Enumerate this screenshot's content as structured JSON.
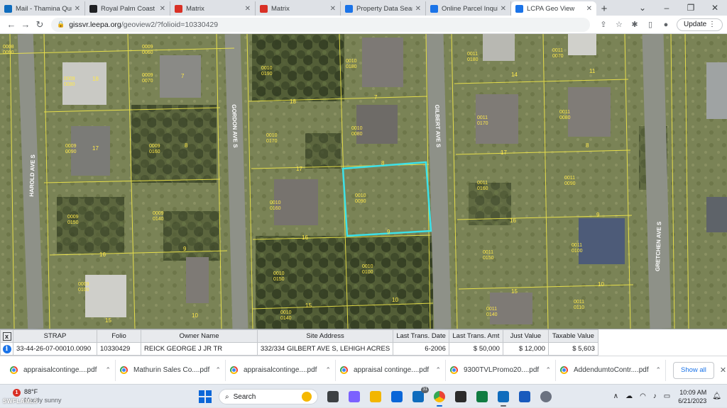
{
  "browser": {
    "tabs": [
      {
        "title": "Mail - Thamina Qures",
        "favicon": "outlook-icon",
        "color": "#0f6cbd",
        "active": false
      },
      {
        "title": "Royal Palm Coast REA",
        "favicon": "website-icon",
        "color": "#202124",
        "active": false
      },
      {
        "title": "Matrix",
        "favicon": "matrix-icon",
        "color": "#d93025",
        "active": false
      },
      {
        "title": "Matrix",
        "favicon": "matrix-icon",
        "color": "#d93025",
        "active": false
      },
      {
        "title": "Property Data Search",
        "favicon": "globe-icon",
        "color": "#1a73e8",
        "active": false
      },
      {
        "title": "Online Parcel Inquiry",
        "favicon": "globe-icon",
        "color": "#1a73e8",
        "active": false
      },
      {
        "title": "LCPA Geo View",
        "favicon": "globe-icon",
        "color": "#1a73e8",
        "active": true
      }
    ],
    "url_host": "gissvr.leepa.org",
    "url_path": "/geoview2/?folioid=10330429",
    "update_label": "Update"
  },
  "map": {
    "streets": [
      "HAROLD AVE S",
      "GORDON AVE S",
      "GILBERT AVE S",
      "GRETCHEN AVE S"
    ],
    "parcels": [
      {
        "id": "0008",
        "sub": "0090"
      },
      {
        "id": "0009",
        "sub": "0060"
      },
      {
        "id": "0009",
        "sub": "0070"
      },
      {
        "id": "0009",
        "sub": "0080"
      },
      {
        "id": "0009",
        "sub": "0090"
      },
      {
        "id": "0009",
        "sub": "0160"
      },
      {
        "id": "0009",
        "sub": "0150"
      },
      {
        "id": "0009",
        "sub": "0140"
      },
      {
        "id": "0009",
        "sub": "0100"
      },
      {
        "id": "0010",
        "sub": "0190"
      },
      {
        "id": "0010",
        "sub": "0180"
      },
      {
        "id": "0010",
        "sub": "0170"
      },
      {
        "id": "0010",
        "sub": "0080"
      },
      {
        "id": "0010",
        "sub": "0160"
      },
      {
        "id": "0010",
        "sub": "0090"
      },
      {
        "id": "0010",
        "sub": "0150"
      },
      {
        "id": "0010",
        "sub": "0100"
      },
      {
        "id": "0010",
        "sub": "0140"
      },
      {
        "id": "0011",
        "sub": "0180"
      },
      {
        "id": "0011",
        "sub": "0070"
      },
      {
        "id": "0011",
        "sub": "0170"
      },
      {
        "id": "0011",
        "sub": "0080"
      },
      {
        "id": "0011",
        "sub": "0160"
      },
      {
        "id": "0011",
        "sub": "0090"
      },
      {
        "id": "0011",
        "sub": "0150"
      },
      {
        "id": "0011",
        "sub": "0100"
      },
      {
        "id": "0011",
        "sub": "0140"
      },
      {
        "id": "0011",
        "sub": "0110"
      }
    ],
    "lot_numbers": [
      "18",
      "7",
      "17",
      "8",
      "16",
      "9",
      "15",
      "10",
      "14",
      "18",
      "7",
      "17",
      "8",
      "16",
      "9",
      "15",
      "10",
      "14",
      "11",
      "17",
      "8",
      "16",
      "9",
      "15",
      "10",
      "14",
      "11"
    ],
    "highlight_color": "#3de1e8"
  },
  "property_grid": {
    "columns": [
      "STRAP",
      "Folio",
      "Owner Name",
      "Site Address",
      "Last Trans. Date",
      "Last Trans. Amt",
      "Just Value",
      "Taxable Value"
    ],
    "row": [
      "33-44-26-07-00010.0090",
      "10330429",
      "REICK GEORGE J JR TR",
      "332/334 GILBERT AVE S, LEHIGH ACRES",
      "6-2006",
      "$ 50,000",
      "$ 12,000",
      "$ 5,603"
    ]
  },
  "downloads": {
    "items": [
      "appraisalcontinge....pdf",
      "Mathurin Sales Co....pdf",
      "appraisalcontinge....pdf",
      "appraisal continge....pdf",
      "9300TVLPromo20....pdf",
      "AddendumtoContr....pdf"
    ],
    "show_all_label": "Show all"
  },
  "taskbar": {
    "weather_temp": "88°F",
    "weather_cond": "Mostly sunny",
    "weather_badge": "1",
    "search_label": "Search",
    "mail_badge": "31",
    "time": "10:09 AM",
    "date": "6/21/2023"
  },
  "watermark": "SWFLAMLS"
}
